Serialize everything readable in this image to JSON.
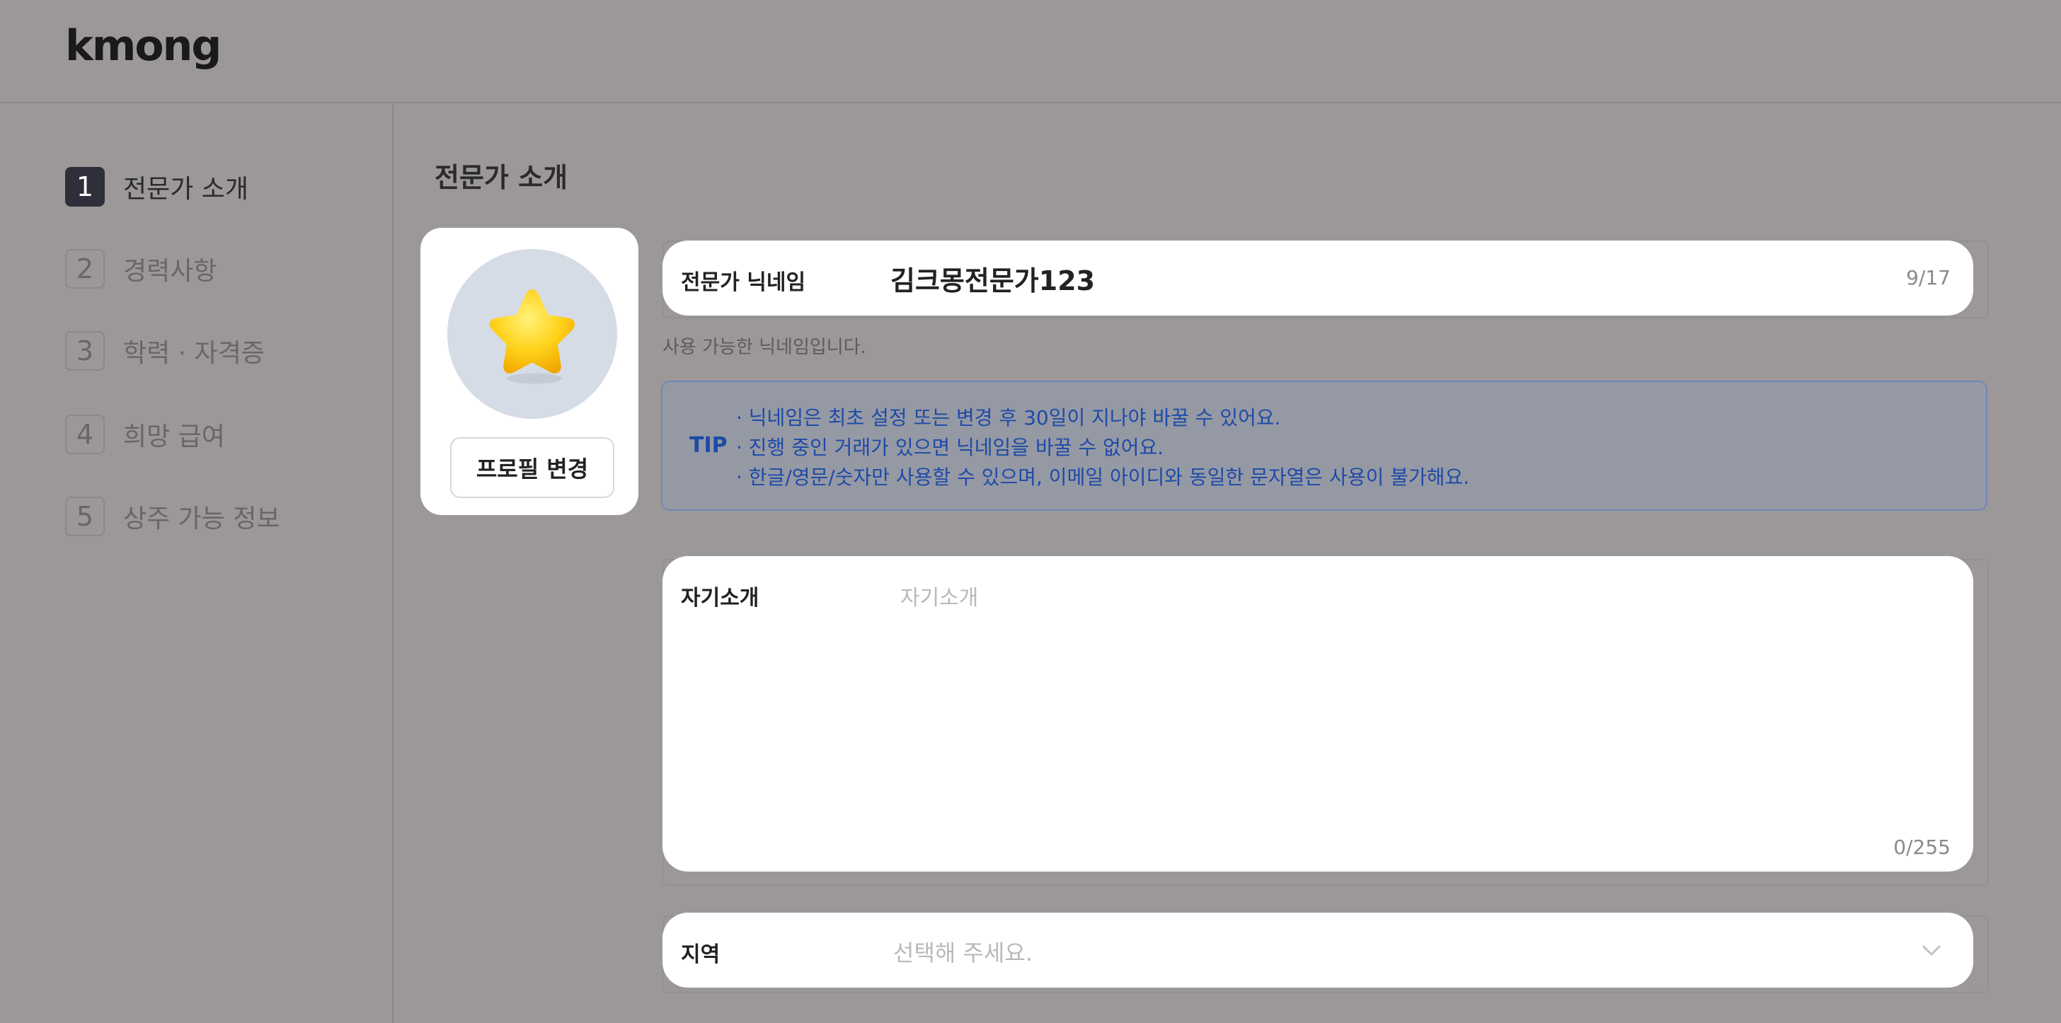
{
  "header": {
    "logo": "kmong"
  },
  "steps": [
    {
      "num": "1",
      "label": "전문가 소개",
      "active": true
    },
    {
      "num": "2",
      "label": "경력사항",
      "active": false
    },
    {
      "num": "3",
      "label": "학력 · 자격증",
      "active": false
    },
    {
      "num": "4",
      "label": "희망 급여",
      "active": false
    },
    {
      "num": "5",
      "label": "상주 가능 정보",
      "active": false
    }
  ],
  "main": {
    "title": "전문가 소개",
    "profile_button": "프로필 변경",
    "nickname": {
      "label": "전문가 닉네임",
      "value": "김크몽전문가123",
      "counter": "9/17",
      "hint": "사용 가능한 닉네임입니다."
    },
    "tip": {
      "label": "TIP",
      "lines": [
        "· 닉네임은 최초 설정 또는 변경 후 30일이 지나야 바꿀 수 있어요.",
        "· 진행 중인 거래가 있으면 닉네임을 바꿀 수 없어요.",
        "· 한글/영문/숫자만 사용할 수 있으며, 이메일 아이디와 동일한 문자열은 사용이 불가해요."
      ]
    },
    "intro": {
      "label": "자기소개",
      "placeholder": "자기소개",
      "counter": "0/255"
    },
    "region": {
      "label": "지역",
      "placeholder": "선택해 주세요."
    }
  },
  "colors": {
    "overlay": "#9c9898",
    "active_step": "#2f2f3b",
    "tip_text": "#1e4aa8",
    "avatar_bg": "#d6dce6"
  },
  "icons": {
    "avatar": "star-icon",
    "region_toggle": "chevron-down-icon"
  }
}
